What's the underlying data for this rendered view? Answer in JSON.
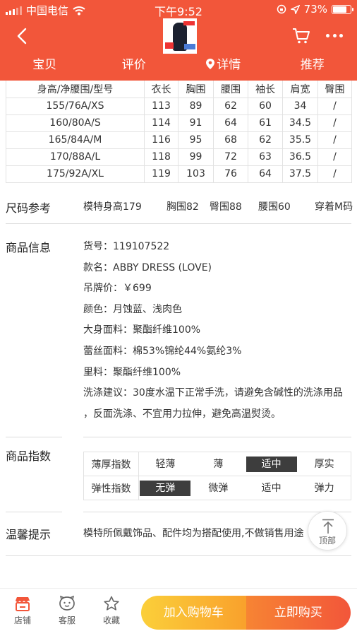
{
  "status": {
    "carrier": "中国电信",
    "time": "下午9:52",
    "battery": "73%"
  },
  "tabs": [
    "宝贝",
    "评价",
    "详情",
    "推荐"
  ],
  "size_table": {
    "headers": [
      "身高/净腰围/型号",
      "衣长",
      "胸围",
      "腰围",
      "袖长",
      "肩宽",
      "臀围"
    ],
    "rows": [
      [
        "155/76A/XS",
        "113",
        "89",
        "62",
        "60",
        "34",
        "/"
      ],
      [
        "160/80A/S",
        "114",
        "91",
        "64",
        "61",
        "34.5",
        "/"
      ],
      [
        "165/84A/M",
        "116",
        "95",
        "68",
        "62",
        "35.5",
        "/"
      ],
      [
        "170/88A/L",
        "118",
        "99",
        "72",
        "63",
        "36.5",
        "/"
      ],
      [
        "175/92A/XL",
        "119",
        "103",
        "76",
        "64",
        "37.5",
        "/"
      ]
    ]
  },
  "size_ref": {
    "label": "尺码参考",
    "items": [
      "模特身高179",
      "胸围82",
      "臀围88",
      "腰围60",
      "穿着M码"
    ]
  },
  "product_info": {
    "label": "商品信息",
    "lines": [
      "货号：119107522",
      "款名：ABBY DRESS (LOVE)",
      "吊牌价：￥699",
      "颜色：月蚀蓝、浅肉色",
      "大身面料：聚酯纤维100%",
      "蕾丝面料：棉53%锦纶44%氨纶3%",
      "里料：聚酯纤维100%",
      "洗涤建议：30度水温下正常手洗，请避免含碱性的洗涤用品",
      "，反面洗涤、不宜用力拉伸，避免高温熨烫。"
    ]
  },
  "product_index": {
    "label": "商品指数",
    "rows": [
      {
        "name": "薄厚指数",
        "options": [
          "轻薄",
          "薄",
          "适中",
          "厚实"
        ],
        "selected": 2
      },
      {
        "name": "弹性指数",
        "options": [
          "无弹",
          "微弹",
          "适中",
          "弹力"
        ],
        "selected": 0
      }
    ]
  },
  "tips": {
    "label": "温馨提示",
    "text": "模特所佩戴饰品、配件均为搭配使用,不做销售用途"
  },
  "top_button": "顶部",
  "bottom": {
    "store": "店铺",
    "service": "客服",
    "favorite": "收藏",
    "add_cart": "加入购物车",
    "buy_now": "立即购买"
  },
  "colors": {
    "brand": "#f2563a",
    "cart_btn": "#fbbf35",
    "buy_btn": "#f2563a",
    "selected": "#3d3d3d"
  },
  "icons": [
    "back-arrow-icon",
    "cart-icon",
    "more-icon",
    "location-pin-icon",
    "arrow-up-icon",
    "store-icon",
    "service-icon",
    "star-icon"
  ]
}
